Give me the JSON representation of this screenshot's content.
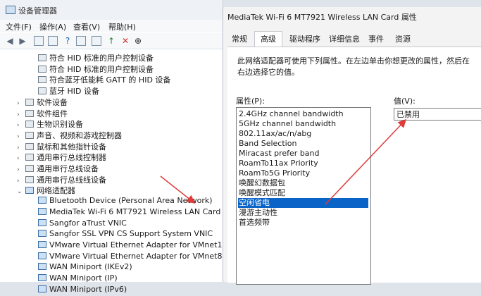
{
  "device_manager": {
    "title": "设备管理器",
    "menu": [
      "文件(F)",
      "操作(A)",
      "查看(V)",
      "帮助(H)"
    ],
    "tree": [
      {
        "label": "符合 HID 标准的用户控制设备",
        "indent": 2,
        "icon": "device-icon",
        "exp": ""
      },
      {
        "label": "符合 HID 标准的用户控制设备",
        "indent": 2,
        "icon": "device-icon",
        "exp": ""
      },
      {
        "label": "符合蓝牙低能耗 GATT 的 HID 设备",
        "indent": 2,
        "icon": "device-icon",
        "exp": ""
      },
      {
        "label": "蓝牙 HID 设备",
        "indent": 2,
        "icon": "device-icon",
        "exp": ""
      },
      {
        "label": "软件设备",
        "indent": 1,
        "icon": "device-icon",
        "exp": "›"
      },
      {
        "label": "软件组件",
        "indent": 1,
        "icon": "device-icon",
        "exp": "›"
      },
      {
        "label": "生物识别设备",
        "indent": 1,
        "icon": "device-icon",
        "exp": "›"
      },
      {
        "label": "声音、视频和游戏控制器",
        "indent": 1,
        "icon": "device-icon",
        "exp": "›"
      },
      {
        "label": "鼠标和其他指针设备",
        "indent": 1,
        "icon": "device-icon",
        "exp": "›"
      },
      {
        "label": "通用串行总线控制器",
        "indent": 1,
        "icon": "device-icon",
        "exp": "›"
      },
      {
        "label": "通用串行总线设备",
        "indent": 1,
        "icon": "device-icon",
        "exp": "›"
      },
      {
        "label": "通用串行总线线设备",
        "indent": 1,
        "icon": "device-icon",
        "exp": "›"
      },
      {
        "label": "网络适配器",
        "indent": 1,
        "icon": "network-icon",
        "exp": "⌄"
      },
      {
        "label": "Bluetooth Device (Personal Area Network)",
        "indent": 2,
        "icon": "network-icon",
        "exp": ""
      },
      {
        "label": "MediaTek Wi-Fi 6 MT7921 Wireless LAN Card",
        "indent": 2,
        "icon": "network-icon",
        "exp": ""
      },
      {
        "label": "Sangfor aTrust VNIC",
        "indent": 2,
        "icon": "network-icon",
        "exp": ""
      },
      {
        "label": "Sangfor SSL VPN CS Support System VNIC",
        "indent": 2,
        "icon": "network-icon",
        "exp": ""
      },
      {
        "label": "VMware Virtual Ethernet Adapter for VMnet1",
        "indent": 2,
        "icon": "network-icon",
        "exp": ""
      },
      {
        "label": "VMware Virtual Ethernet Adapter for VMnet8",
        "indent": 2,
        "icon": "network-icon",
        "exp": ""
      },
      {
        "label": "WAN Miniport (IKEv2)",
        "indent": 2,
        "icon": "network-icon",
        "exp": ""
      },
      {
        "label": "WAN Miniport (IP)",
        "indent": 2,
        "icon": "network-icon",
        "exp": ""
      },
      {
        "label": "WAN Miniport (IPv6)",
        "indent": 2,
        "icon": "network-icon",
        "exp": ""
      }
    ]
  },
  "properties": {
    "title": "MediaTek Wi-Fi 6 MT7921 Wireless LAN Card 属性",
    "tabs": [
      "常规",
      "高级",
      "驱动程序",
      "详细信息",
      "事件",
      "资源"
    ],
    "active_tab": "高级",
    "description": "此网络适配器可使用下列属性。在左边单击你想更改的属性，然后在右边选择它的值。",
    "property_label": "属性(P):",
    "value_label": "值(V):",
    "items": [
      "2.4GHz channel bandwidth",
      "5GHz channel bandwidth",
      "802.11ax/ac/n/abg",
      "Band Selection",
      "Miracast prefer band",
      "RoamTo11ax Priority",
      "RoamTo5G Priority",
      "唤醒幻数据包",
      "唤醒模式匹配",
      "空闲省电",
      "漫游主动性",
      "首选频带"
    ],
    "selected_index": 9,
    "value": "已禁用"
  },
  "colors": {
    "selection": "#0a64c8",
    "arrow": "#e03a3a"
  }
}
